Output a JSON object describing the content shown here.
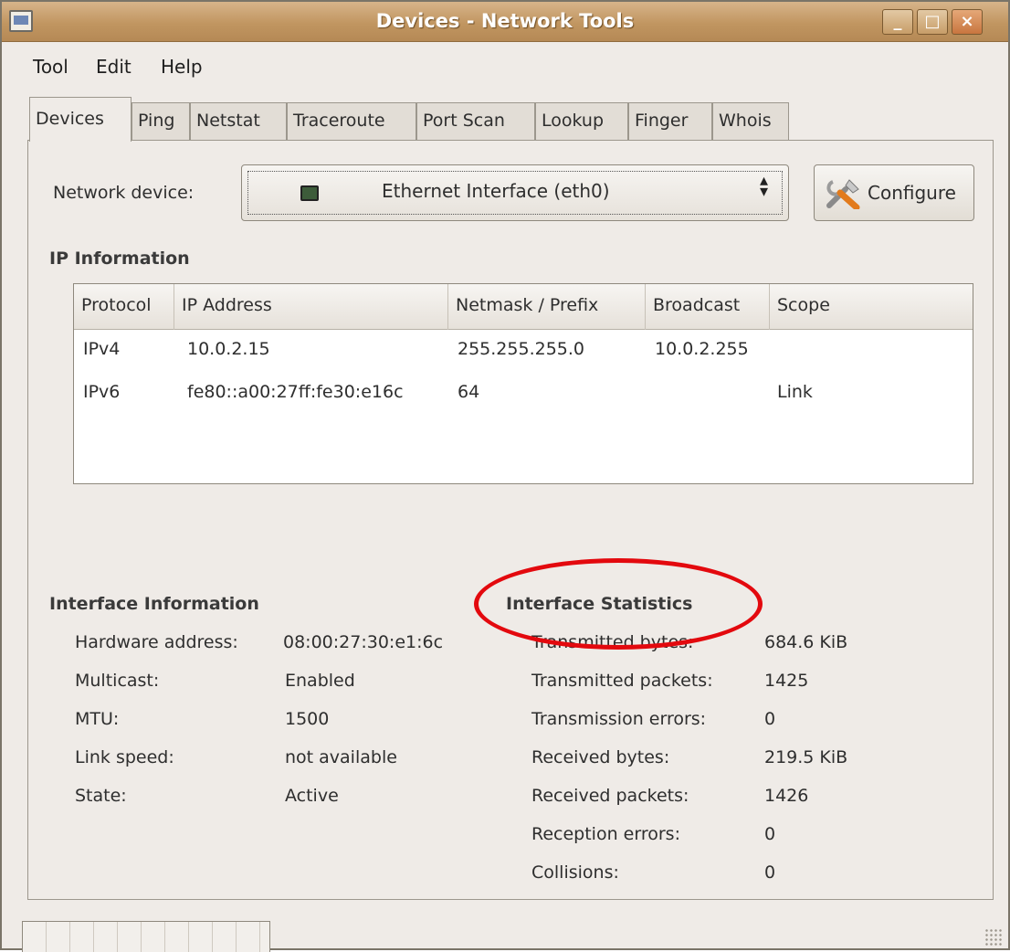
{
  "window": {
    "title": "Devices - Network Tools"
  },
  "menu": [
    "Tool",
    "Edit",
    "Help"
  ],
  "tabs": [
    "Devices",
    "Ping",
    "Netstat",
    "Traceroute",
    "Port Scan",
    "Lookup",
    "Finger",
    "Whois"
  ],
  "active_tab": "Devices",
  "device": {
    "label": "Network device:",
    "selected": "Ethernet Interface (eth0)",
    "configure_label": "Configure",
    "icon": "network-card-icon"
  },
  "ip_info": {
    "title": "IP Information",
    "columns": [
      "Protocol",
      "IP Address",
      "Netmask / Prefix",
      "Broadcast",
      "Scope"
    ],
    "rows": [
      [
        "IPv4",
        "10.0.2.15",
        "255.255.255.0",
        "10.0.2.255",
        ""
      ],
      [
        "IPv6",
        "fe80::a00:27ff:fe30:e16c",
        "64",
        "",
        "Link"
      ]
    ]
  },
  "interface_info": {
    "title": "Interface Information",
    "rows": [
      {
        "label": "Hardware address:",
        "value": "08:00:27:30:e1:6c"
      },
      {
        "label": "Multicast:",
        "value": "Enabled"
      },
      {
        "label": "MTU:",
        "value": "1500"
      },
      {
        "label": "Link speed:",
        "value": "not available"
      },
      {
        "label": "State:",
        "value": "Active"
      }
    ]
  },
  "interface_stats": {
    "title": "Interface Statistics",
    "rows": [
      {
        "label": "Transmitted bytes:",
        "value": "684.6 KiB"
      },
      {
        "label": "Transmitted packets:",
        "value": "1425"
      },
      {
        "label": "Transmission errors:",
        "value": "0"
      },
      {
        "label": "Received bytes:",
        "value": "219.5 KiB"
      },
      {
        "label": "Received packets:",
        "value": "1426"
      },
      {
        "label": "Reception errors:",
        "value": "0"
      },
      {
        "label": "Collisions:",
        "value": "0"
      }
    ]
  },
  "annotation": {
    "color": "#e3090e"
  }
}
